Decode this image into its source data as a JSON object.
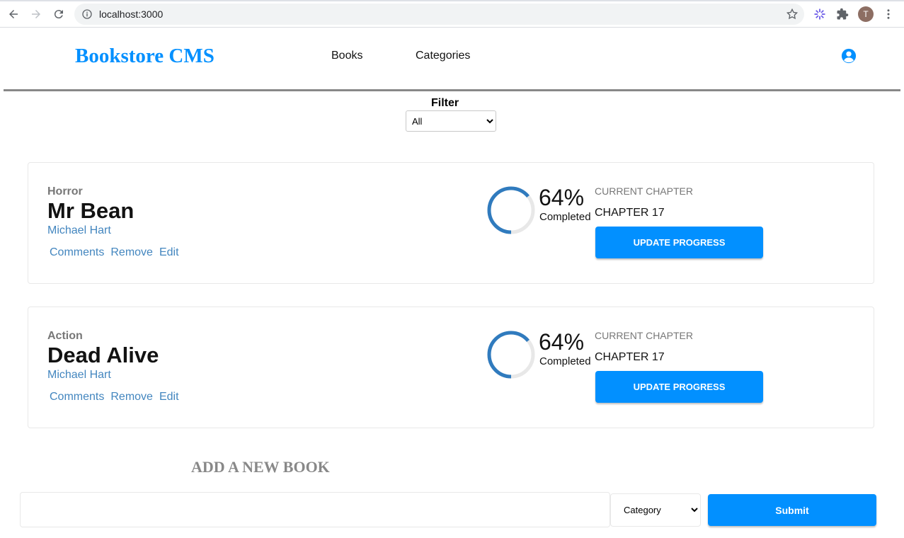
{
  "browser": {
    "url": "localhost:3000",
    "profile_initial": "T"
  },
  "header": {
    "brand": "Bookstore CMS",
    "nav": [
      "Books",
      "Categories"
    ]
  },
  "filter": {
    "label": "Filter",
    "selected": "All"
  },
  "books": [
    {
      "category": "Horror",
      "title": "Mr Bean",
      "author": "Michael Hart",
      "actions": [
        "Comments",
        "Remove",
        "Edit"
      ],
      "percent": "64%",
      "progress": 0.64,
      "completed_label": "Completed",
      "chapter_heading": "CURRENT CHAPTER",
      "chapter": "CHAPTER 17",
      "update_label": "UPDATE PROGRESS"
    },
    {
      "category": "Action",
      "title": "Dead Alive",
      "author": "Michael Hart",
      "actions": [
        "Comments",
        "Remove",
        "Edit"
      ],
      "percent": "64%",
      "progress": 0.64,
      "completed_label": "Completed",
      "chapter_heading": "CURRENT CHAPTER",
      "chapter": "CHAPTER 17",
      "update_label": "UPDATE PROGRESS"
    }
  ],
  "add_book": {
    "title": "ADD A NEW BOOK",
    "input_value": "",
    "category_selected": "Category",
    "submit_label": "Submit"
  },
  "colors": {
    "accent": "#0290ff",
    "link": "#4386bf",
    "progress": "#307bbe",
    "progress_track": "#e8e8e8"
  }
}
